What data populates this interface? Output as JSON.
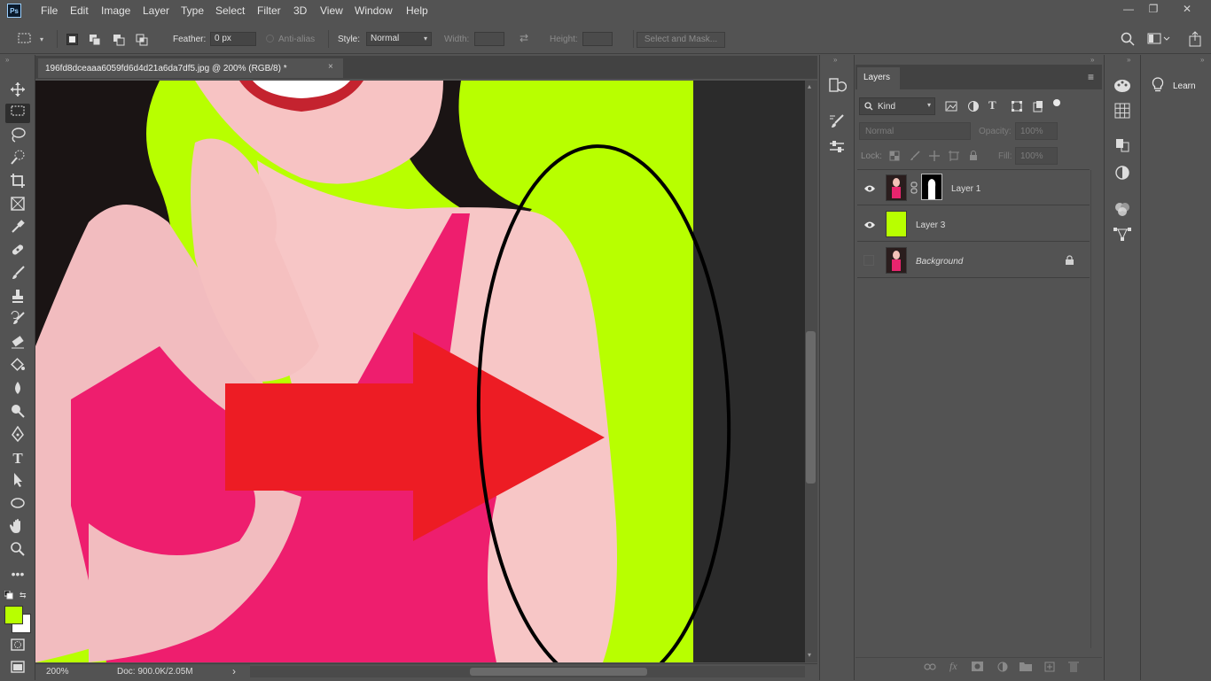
{
  "app": {
    "logo_text": "Ps"
  },
  "menu": [
    "File",
    "Edit",
    "Image",
    "Layer",
    "Type",
    "Select",
    "Filter",
    "3D",
    "View",
    "Window",
    "Help"
  ],
  "window_controls": {
    "minimize": "—",
    "restore": "❐",
    "close": "✕"
  },
  "options_bar": {
    "feather_label": "Feather:",
    "feather_value": "0 px",
    "antialias_label": "Anti-alias",
    "style_label": "Style:",
    "style_value": "Normal",
    "width_label": "Width:",
    "height_label": "Height:",
    "select_mask_label": "Select and Mask..."
  },
  "document": {
    "tab_title": "196fd8dceaaa6059fd6d4d21a6da7df5.jpg @ 200% (RGB/8) *",
    "close_glyph": "×"
  },
  "status_bar": {
    "zoom": "200%",
    "doc_info": "Doc: 900.0K/2.05M",
    "arrow": "›"
  },
  "layers_panel": {
    "tab_label": "Layers",
    "filter_kind": "Kind",
    "blend_mode": "Normal",
    "opacity_label": "Opacity:",
    "opacity_value": "100%",
    "lock_label": "Lock:",
    "fill_label": "Fill:",
    "fill_value": "100%",
    "layers": [
      {
        "name": "Layer 1",
        "visible": true,
        "italic": false
      },
      {
        "name": "Layer 3",
        "visible": true,
        "italic": false
      },
      {
        "name": "Background",
        "visible": false,
        "italic": true
      }
    ],
    "footer_icons": [
      "link-icon",
      "fx-icon",
      "mask-icon",
      "adjustment-icon",
      "folder-icon",
      "new-layer-icon",
      "trash-icon"
    ]
  },
  "learn_panel": {
    "label": "Learn"
  },
  "colors": {
    "ui_bg": "#535353",
    "canvas_green": "#b8ff00",
    "arrow_red": "#ed1c24",
    "foreground_swatch": "#b8ff00",
    "background_swatch": "#ffffff"
  }
}
